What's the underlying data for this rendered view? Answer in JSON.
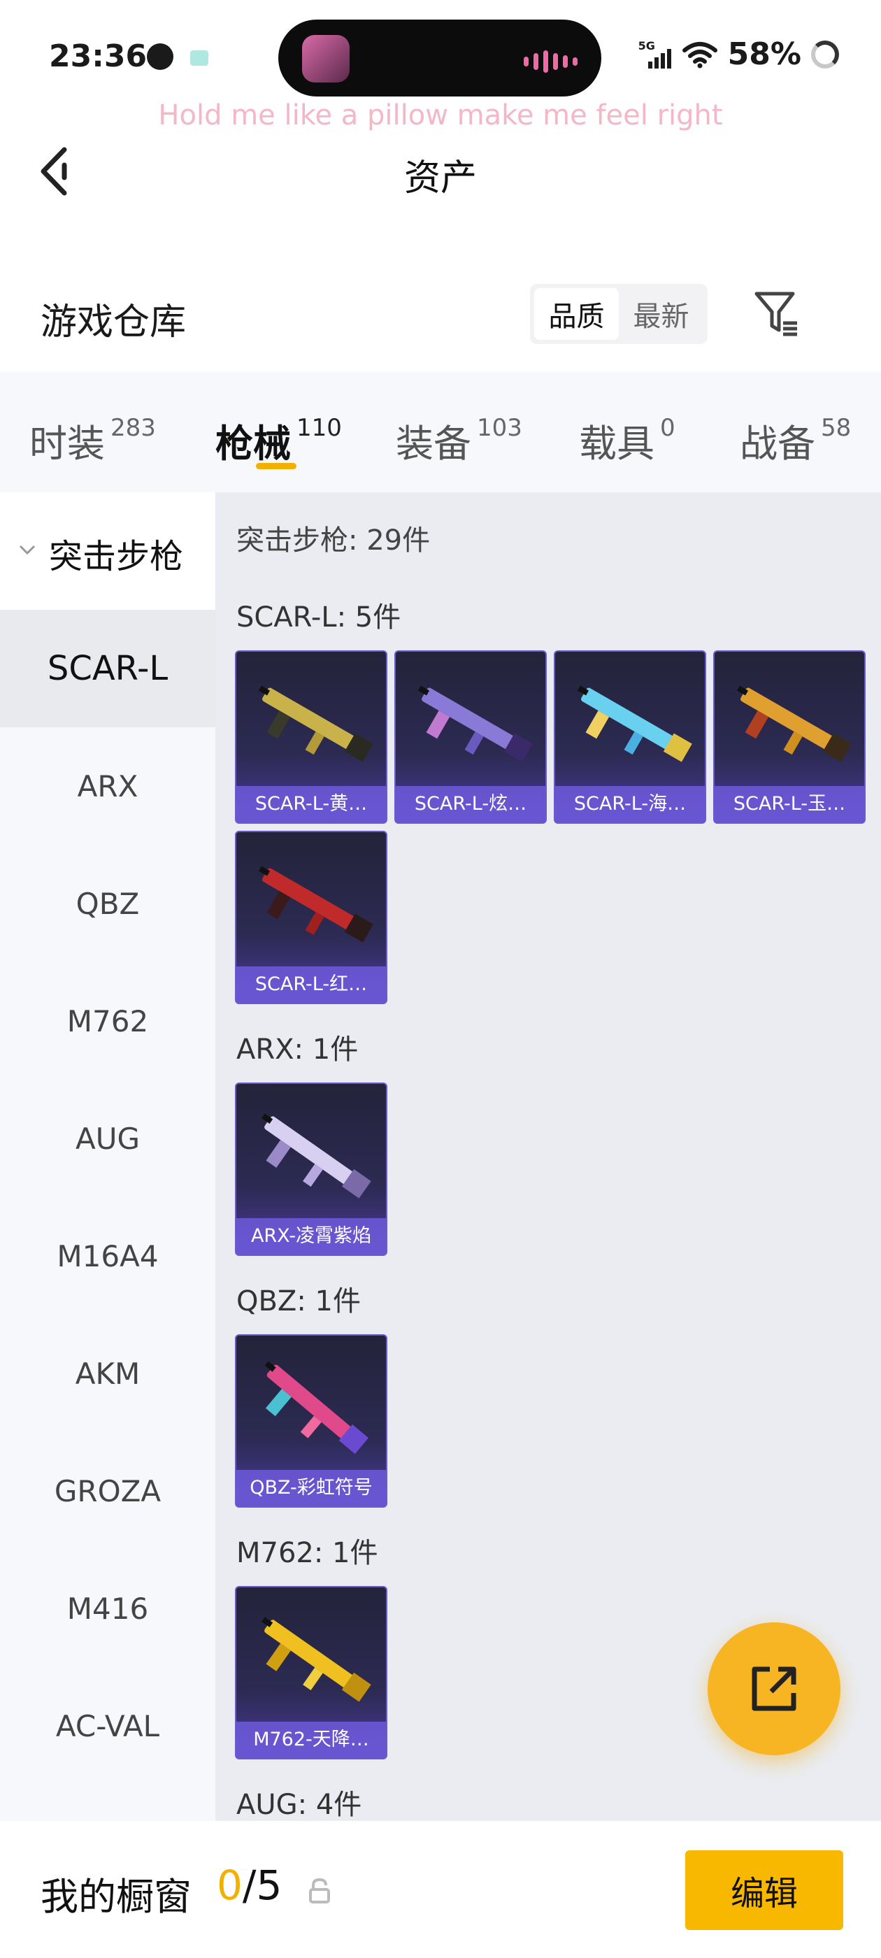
{
  "status_bar": {
    "time": "23:36",
    "network": "5G",
    "battery": "58%"
  },
  "now_playing_lyric": "Hold me like a pillow make me feel right",
  "header": {
    "title": "资产"
  },
  "warehouse": {
    "title": "游戏仓库",
    "sort_options": [
      "品质",
      "最新"
    ],
    "active_sort": "品质"
  },
  "tabs": [
    {
      "label": "时装",
      "count": "283"
    },
    {
      "label": "枪械",
      "count": "110"
    },
    {
      "label": "装备",
      "count": "103"
    },
    {
      "label": "载具",
      "count": "0"
    },
    {
      "label": "战备",
      "count": "58"
    }
  ],
  "active_tab": "枪械",
  "sidebar": {
    "category": "突击步枪",
    "items": [
      "SCAR-L",
      "ARX",
      "QBZ",
      "M762",
      "AUG",
      "M16A4",
      "AKM",
      "GROZA",
      "M416",
      "AC-VAL"
    ],
    "active_item": "SCAR-L"
  },
  "content": {
    "section_header": "突击步枪: 29件",
    "groups": [
      {
        "header": "SCAR-L: 5件",
        "items": [
          "SCAR-L-黄…",
          "SCAR-L-炫…",
          "SCAR-L-海…",
          "SCAR-L-玉…",
          "SCAR-L-红…"
        ]
      },
      {
        "header": "ARX: 1件",
        "items": [
          "ARX-凌霄紫焰"
        ]
      },
      {
        "header": "QBZ: 1件",
        "items": [
          "QBZ-彩虹符号"
        ]
      },
      {
        "header": "M762: 1件",
        "items": [
          "M762-天降…"
        ]
      },
      {
        "header": "AUG: 4件",
        "items": []
      }
    ]
  },
  "bottom_bar": {
    "label": "我的橱窗",
    "current": "0",
    "total": "/5",
    "edit_label": "编辑"
  },
  "colors": {
    "accent": "#f9b800",
    "card_bg": "#2c2a52",
    "card_label": "#6e5adc"
  },
  "icons": [
    "back-arrow-icon",
    "filter-icon",
    "chevron-down-icon",
    "share-icon",
    "lock-icon",
    "wifi-icon",
    "signal-icon"
  ]
}
